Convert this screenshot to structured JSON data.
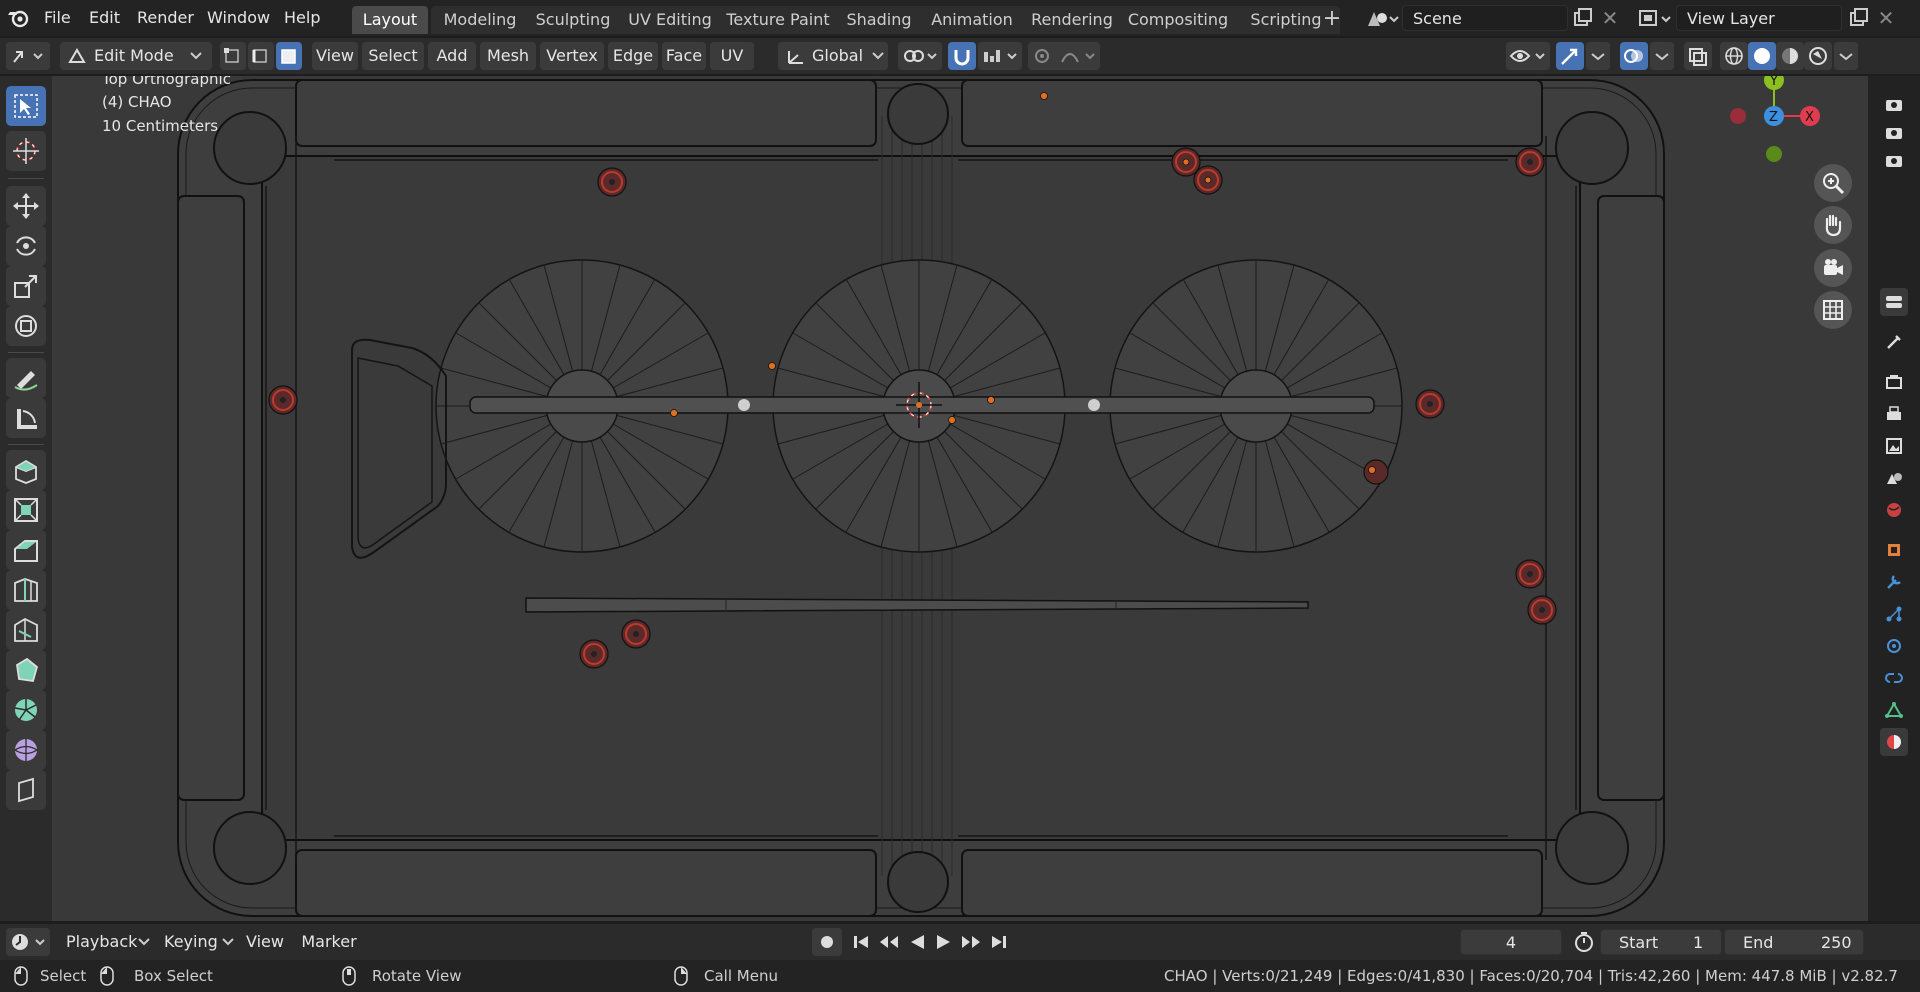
{
  "topbar": {
    "menus": [
      "File",
      "Edit",
      "Render",
      "Window",
      "Help"
    ],
    "workspace_tabs": [
      "Layout",
      "Modeling",
      "Sculpting",
      "UV Editing",
      "Texture Paint",
      "Shading",
      "Animation",
      "Rendering",
      "Compositing",
      "Scripting"
    ],
    "active_tab_index": 0,
    "scene": "Scene",
    "view_layer": "View Layer"
  },
  "header": {
    "mode": "Edit Mode",
    "menus": [
      "View",
      "Select",
      "Add",
      "Mesh",
      "Vertex",
      "Edge",
      "Face",
      "UV"
    ],
    "transform_orientation": "Global"
  },
  "viewport": {
    "view_name": "Top Orthographic",
    "object_label": "(4) CHAO",
    "scale_label": "10 Centimeters",
    "gizmo": {
      "y": "Y",
      "z": "Z",
      "x": "X"
    }
  },
  "timeline": {
    "menus": [
      "Playback",
      "Keying",
      "View",
      "Marker"
    ],
    "current_frame": "4",
    "start_label": "Start",
    "start_value": "1",
    "end_label": "End",
    "end_value": "250"
  },
  "status": {
    "select": "Select",
    "box_select": "Box Select",
    "rotate_view": "Rotate View",
    "call_menu": "Call Menu",
    "stats": "CHAO | Verts:0/21,249 | Edges:0/41,830 | Faces:0/20,704 | Tris:42,260 | Mem: 447.8 MiB | v2.82.7"
  },
  "colors": {
    "accent": "#4772b3",
    "axis_x": "#e03c4f",
    "axis_y": "#8bc020",
    "axis_z": "#3d8fe0"
  },
  "icons": [
    "blender-logo-icon",
    "select-box-icon",
    "cursor-icon",
    "move-icon",
    "rotate-icon",
    "scale-icon",
    "transform-icon",
    "annotate-icon",
    "measure-icon",
    "extrude-icon",
    "inset-icon",
    "bevel-icon",
    "loopcut-icon",
    "knife-icon",
    "polybuild-icon",
    "spin-icon",
    "smooth-icon",
    "shear-icon",
    "zoom-icon",
    "pan-hand-icon",
    "camera-icon",
    "grid-icon"
  ]
}
